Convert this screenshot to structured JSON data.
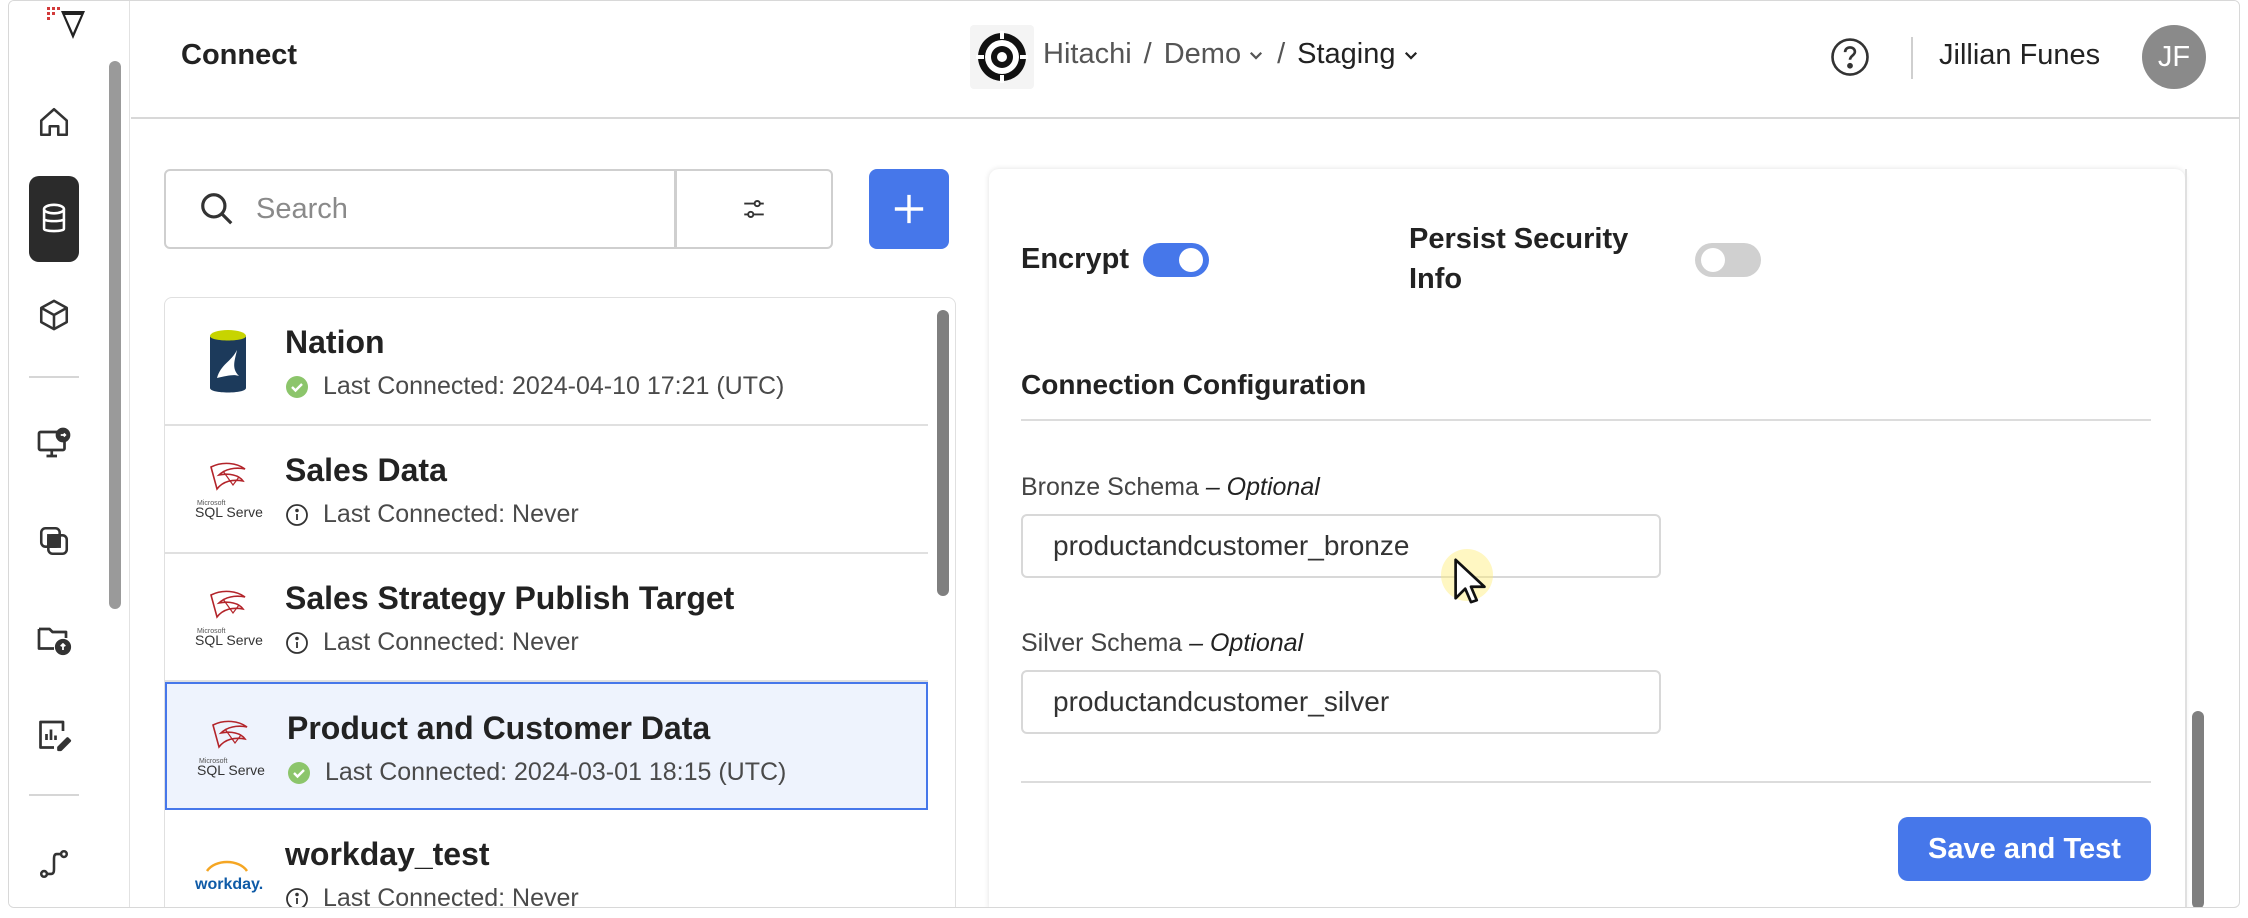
{
  "header": {
    "app_title": "Connect",
    "org": "Hitachi",
    "separator": "/",
    "project": "Demo",
    "environment": "Staging",
    "user_name": "Jillian Funes",
    "user_initials": "JF"
  },
  "sidebar": {
    "items": [
      {
        "name": "home-icon",
        "active": false
      },
      {
        "name": "database-icon",
        "active": true
      },
      {
        "name": "cube-icon",
        "active": false
      },
      {
        "name": "monitor-sync-icon",
        "active": false
      },
      {
        "name": "layers-icon",
        "active": false
      },
      {
        "name": "folder-upload-icon",
        "active": false
      },
      {
        "name": "report-edit-icon",
        "active": false
      },
      {
        "name": "pipeline-icon",
        "active": false
      }
    ]
  },
  "search": {
    "placeholder": "Search"
  },
  "connections": [
    {
      "name": "Nation",
      "status": "Last Connected: 2024-04-10 17:21 (UTC)",
      "status_type": "success",
      "logo": "mysql-icon"
    },
    {
      "name": "Sales Data",
      "status": "Last Connected: Never",
      "status_type": "info",
      "logo": "sqlserver-icon"
    },
    {
      "name": "Sales Strategy Publish Target",
      "status": "Last Connected: Never",
      "status_type": "info",
      "logo": "sqlserver-icon"
    },
    {
      "name": "Product and Customer Data",
      "status": "Last Connected: 2024-03-01 18:15 (UTC)",
      "status_type": "success",
      "logo": "sqlserver-icon",
      "selected": true
    },
    {
      "name": "workday_test",
      "status": "Last Connected: Never",
      "status_type": "info",
      "logo": "workday-icon"
    }
  ],
  "logo_text": {
    "sqlserver": "SQL Server",
    "sqlserver_small": "Microsoft",
    "workday": "workday."
  },
  "detail": {
    "encrypt_label": "Encrypt",
    "encrypt_on": true,
    "persist_label_line1": "Persist Security",
    "persist_label_line2": "Info",
    "persist_on": false,
    "section_title": "Connection Configuration",
    "bronze_label": "Bronze Schema",
    "bronze_optional": "– Optional",
    "bronze_value": "productandcustomer_bronze",
    "silver_label": "Silver Schema",
    "silver_optional": "– Optional",
    "silver_value": "productandcustomer_silver",
    "save_label": "Save and Test"
  },
  "colors": {
    "accent": "#4677ea",
    "success": "#8cc56b",
    "rail_active": "#2b2b2b"
  }
}
